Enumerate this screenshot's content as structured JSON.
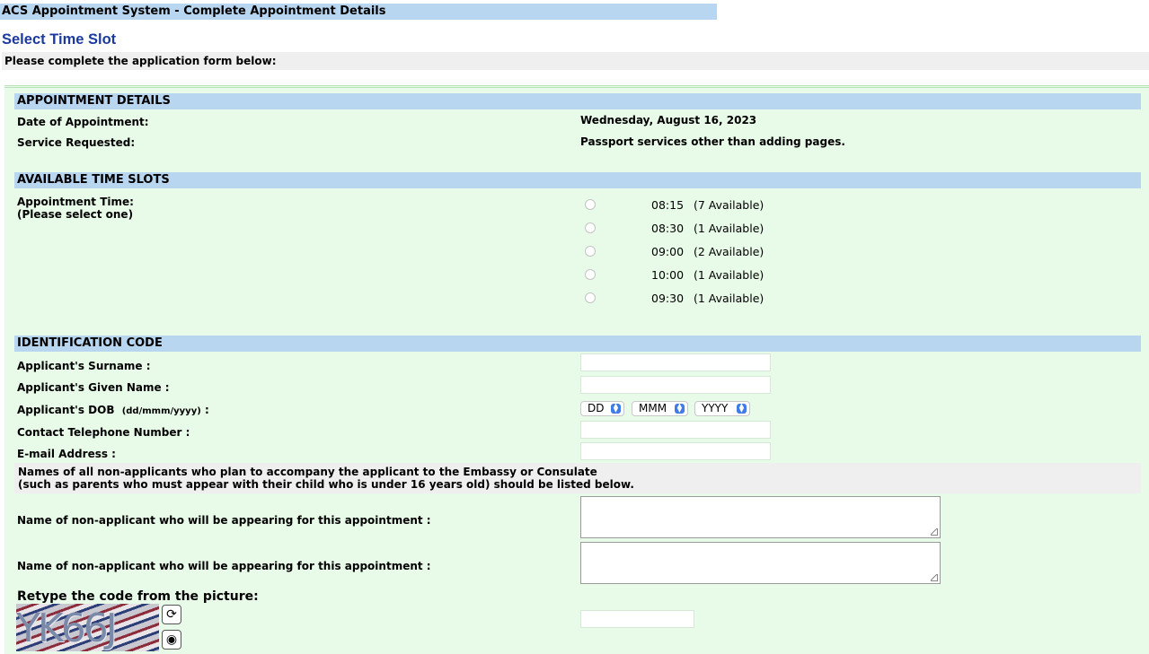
{
  "header": {
    "title": "ACS Appointment System - Complete Appointment Details"
  },
  "page": {
    "title": "Select Time Slot",
    "instruction": "Please complete the application form below:"
  },
  "appointment_details": {
    "heading": "APPOINTMENT DETAILS",
    "date_label": "Date of Appointment:",
    "date_value": "Wednesday, August 16, 2023",
    "service_label": "Service Requested:",
    "service_value": "Passport services other than adding pages."
  },
  "time_slots": {
    "heading": "AVAILABLE TIME SLOTS",
    "label_line1": "Appointment Time:",
    "label_line2": "(Please select one)",
    "slots": [
      {
        "time": "08:15",
        "availability": "(7 Available)"
      },
      {
        "time": "08:30",
        "availability": "(1 Available)"
      },
      {
        "time": "09:00",
        "availability": "(2 Available)"
      },
      {
        "time": "10:00",
        "availability": "(1 Available)"
      },
      {
        "time": "09:30",
        "availability": "(1 Available)"
      }
    ]
  },
  "identification": {
    "heading": "IDENTIFICATION CODE",
    "surname_label": "Applicant's Surname :",
    "surname_value": "",
    "given_name_label": "Applicant's Given Name :",
    "given_name_value": "",
    "dob_label": "Applicant's DOB",
    "dob_format": "(dd/mmm/yyyy)",
    "dob_colon": ":",
    "dob_day": "DD",
    "dob_month": "MMM",
    "dob_year": "YYYY",
    "phone_label": "Contact Telephone Number :",
    "phone_value": "",
    "email_label": "E-mail Address :",
    "email_value": "",
    "note_line1": "Names of all non-applicants who plan to accompany the applicant to the Embassy or Consulate",
    "note_line2": "(such as parents who must appear with their child who is under 16 years old) should be listed below.",
    "non_applicant_label_1": "Name of non-applicant who will be appearing for this appointment :",
    "non_applicant_label_2": "Name of non-applicant who will be appearing for this appointment :",
    "captcha_label": "Retype the code from the picture:",
    "captcha_text": "YK66J",
    "captcha_value": ""
  },
  "icons": {
    "refresh": "refresh-icon",
    "audio": "speaker-icon"
  }
}
